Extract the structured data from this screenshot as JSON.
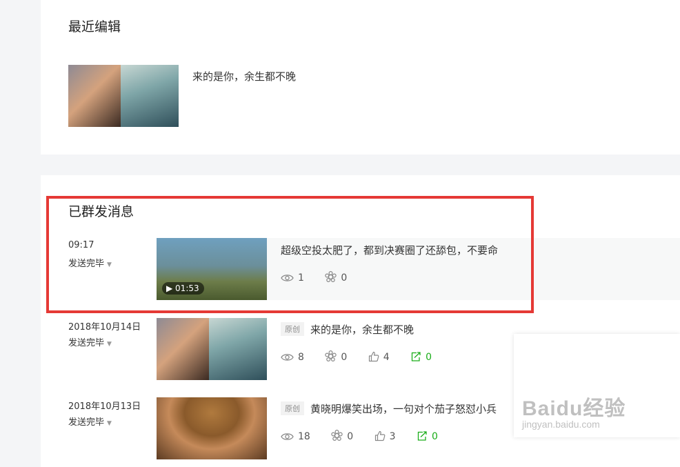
{
  "recent": {
    "title": "最近编辑",
    "item": {
      "title": "来的是你，余生都不晚"
    }
  },
  "sent": {
    "title": "已群发消息",
    "items": [
      {
        "time": "09:17",
        "status": "发送完毕",
        "duration": "▶ 01:53",
        "title": "超级空投太肥了，都到决赛圈了还舔包，不要命",
        "tag": "",
        "views": "1",
        "shares": "0"
      },
      {
        "time": "2018年10月14日",
        "status": "发送完毕",
        "tag": "原创",
        "title": "来的是你，余生都不晚",
        "views": "8",
        "shares": "0",
        "likes": "4",
        "reposts": "0"
      },
      {
        "time": "2018年10月13日",
        "status": "发送完毕",
        "tag": "原创",
        "title": "黄晓明爆笑出场，一句对个茄子怒怼小兵",
        "views": "18",
        "shares": "0",
        "likes": "3",
        "reposts": "0"
      }
    ]
  },
  "watermark": {
    "main": "Baidu经验",
    "sub": "jingyan.baidu.com"
  },
  "icons": [
    "eye-icon",
    "share-flower-icon",
    "thumbs-up-icon",
    "repost-icon",
    "caret-down-icon"
  ],
  "colors": {
    "highlight_border": "#e53935",
    "accent_green": "#1aad19"
  }
}
